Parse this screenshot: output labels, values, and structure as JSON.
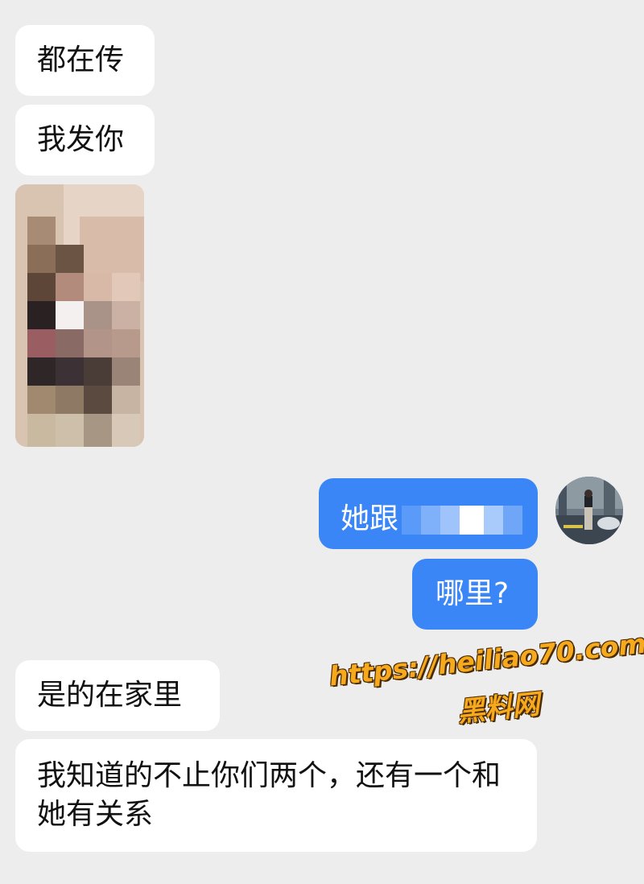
{
  "chat": {
    "messages": [
      {
        "from": "other",
        "text": "都在传"
      },
      {
        "from": "other",
        "text": "我发你"
      },
      {
        "from": "other",
        "type": "image",
        "censored": true
      },
      {
        "from": "me",
        "text": "她跟"
      },
      {
        "from": "me",
        "text": "哪里?"
      },
      {
        "from": "other",
        "text": "是的在家里"
      },
      {
        "from": "other",
        "text": "我知道的不止你们两个，还有一个和她有关系"
      }
    ]
  },
  "watermark": {
    "url": "https://heiliao70.com",
    "name": "黑料网"
  },
  "colors": {
    "background": "#ededed",
    "incoming_bubble": "#ffffff",
    "outgoing_bubble": "#3b86f7",
    "watermark": "#f6a91c"
  }
}
